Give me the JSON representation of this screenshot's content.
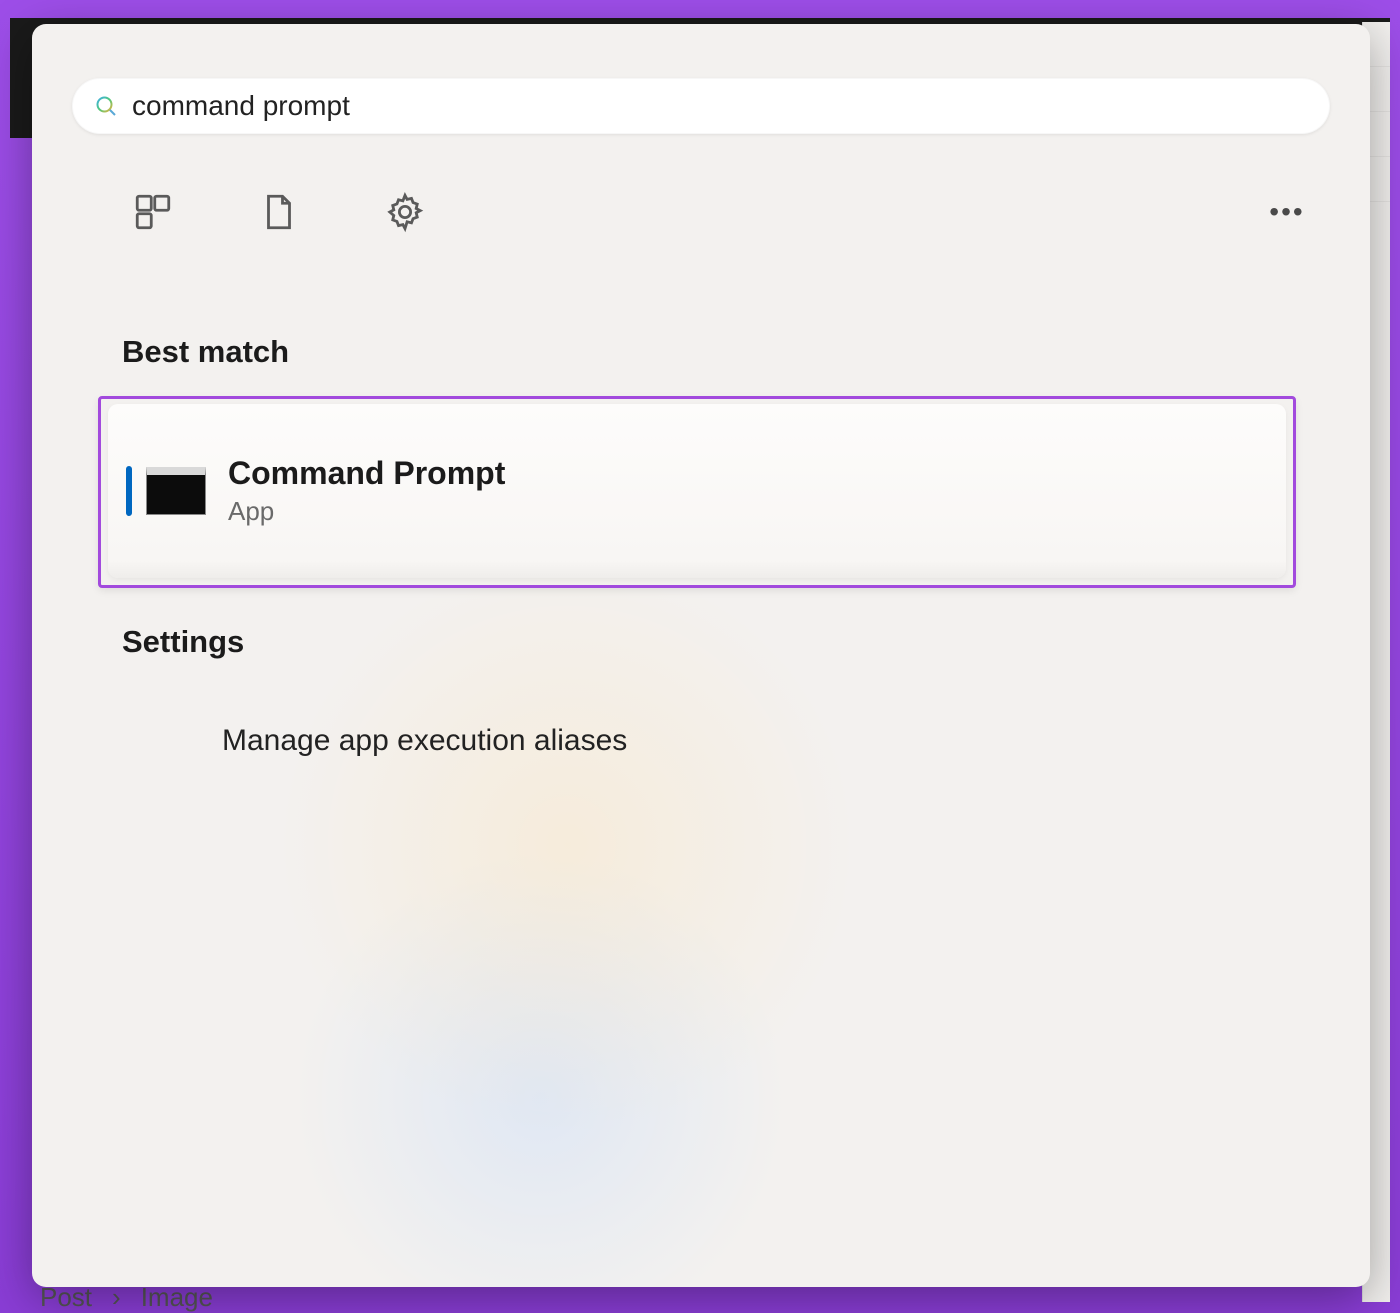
{
  "search": {
    "query": "command prompt"
  },
  "sections": {
    "best_match": "Best match",
    "settings": "Settings"
  },
  "best_match_result": {
    "title": "Command Prompt",
    "subtitle": "App"
  },
  "settings_results": [
    {
      "label": "Manage app execution aliases"
    }
  ],
  "breadcrumb": {
    "a": "Post",
    "b": "Image"
  }
}
